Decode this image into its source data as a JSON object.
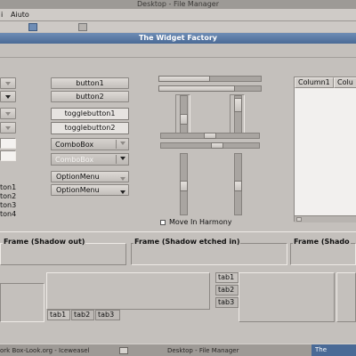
{
  "file_manager": {
    "title": "Desktop - File Manager",
    "menu": {
      "partial": "i",
      "aiuto": "Aiuto"
    }
  },
  "widget_factory": {
    "title": "The Widget Factory",
    "buttons": {
      "button1": "button1",
      "button2": "button2"
    },
    "toggles": {
      "toggle1": "togglebutton1",
      "toggle2": "togglebutton2"
    },
    "combos": {
      "combo1": "ComboBox",
      "combo2": "ComboBox"
    },
    "option_menus": {
      "menu1": "OptionMenu",
      "menu2": "OptionMenu"
    },
    "left_labels": [
      "ton1",
      "ton2",
      "ton3",
      "ton4"
    ],
    "move_in_harmony": "Move In Harmony",
    "tree": {
      "columns": [
        "Column1",
        "Colu"
      ]
    },
    "frames": {
      "shadow_out": "Frame (Shadow out)",
      "shadow_etched_in": "Frame (Shadow etched in)",
      "shadow_partial": "Frame (Shado"
    },
    "tabs_bottom": [
      "tab1",
      "tab2",
      "tab3"
    ],
    "tabs_side": [
      "tab1",
      "tab2",
      "tab3"
    ]
  },
  "taskbar": {
    "items": [
      "ork Box-Look.org - Iceweasel",
      "Desktop - File Manager",
      "The"
    ]
  },
  "colors": {
    "accent": "#4a6a96",
    "window_bg": "#c4c0bc",
    "titlebar_inactive": "#9d9a96"
  },
  "icons": [
    "arrow-down-icon",
    "checkbox-icon",
    "file-manager-icon",
    "taskbar-icon"
  ]
}
